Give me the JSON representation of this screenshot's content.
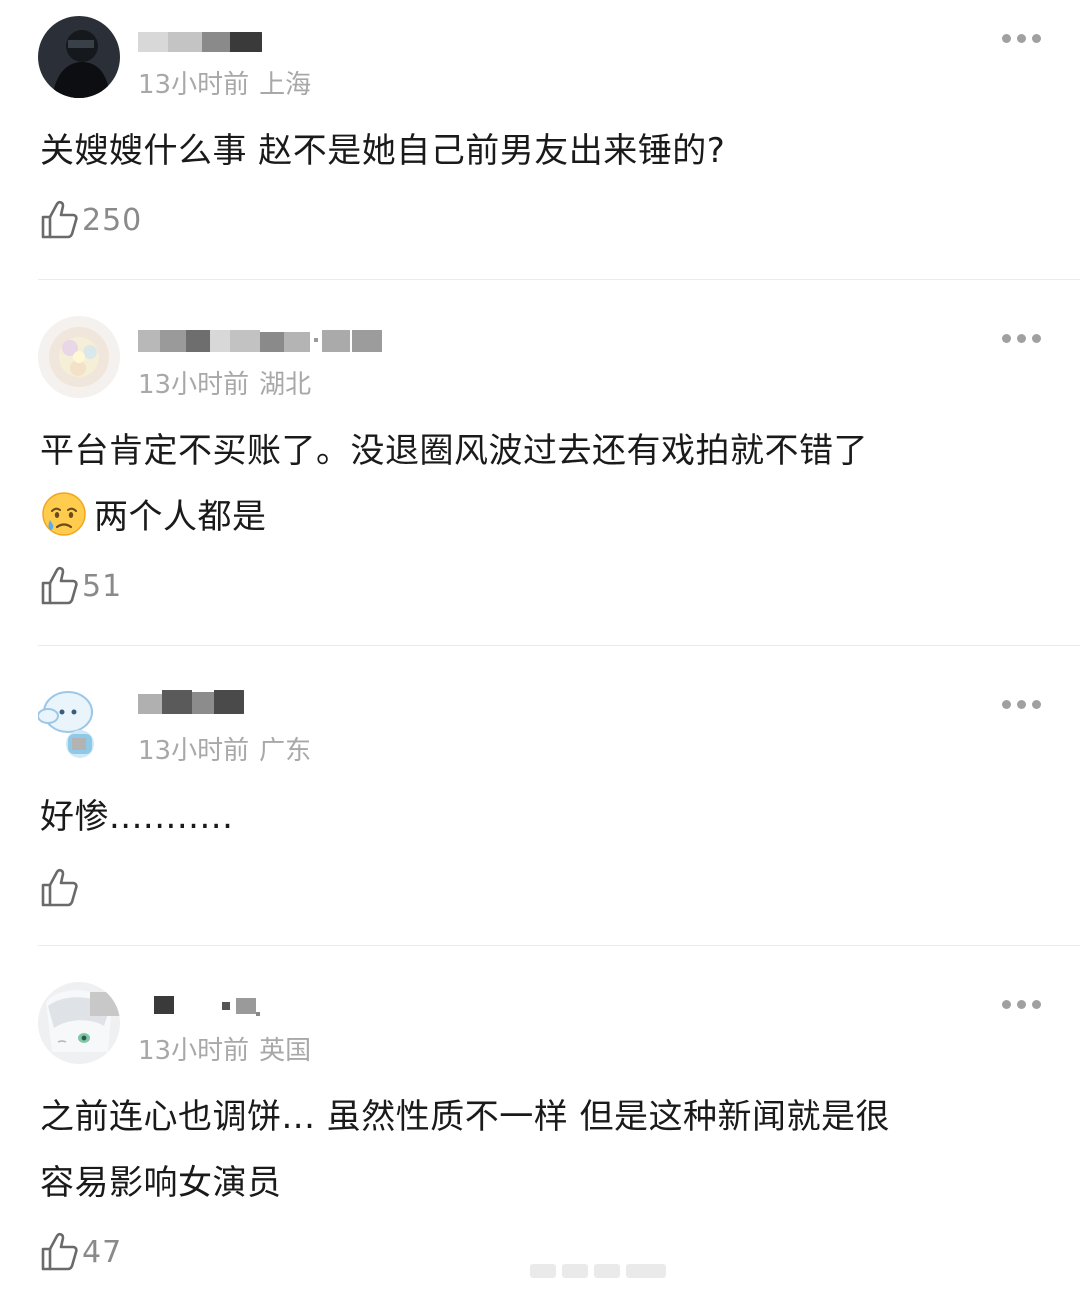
{
  "comments": [
    {
      "time": "13小时前",
      "location": "上海",
      "text": "关嫂嫂什么事 赵不是她自己前男友出来锤的?",
      "likes": "250"
    },
    {
      "time": "13小时前",
      "location": "湖北",
      "text": "平台肯定不买账了。没退圈风波过去还有戏拍就不错了",
      "text2": "两个人都是",
      "likes": "51"
    },
    {
      "time": "13小时前",
      "location": "广东",
      "text": "好惨...........",
      "likes": ""
    },
    {
      "time": "13小时前",
      "location": "英国",
      "text": "之前连心也调饼... 虽然性质不一样 但是这种新闻就是很",
      "text2": "容易影响女演员",
      "likes": "47"
    }
  ],
  "icons": {
    "like": "thumbs-up-outline-icon",
    "more": "more-horizontal-icon",
    "emoji": "crying-face-emoji"
  },
  "colors": {
    "meta": "#a8a8a8",
    "like_count": "#8a8a8a",
    "divider": "#ececec"
  }
}
